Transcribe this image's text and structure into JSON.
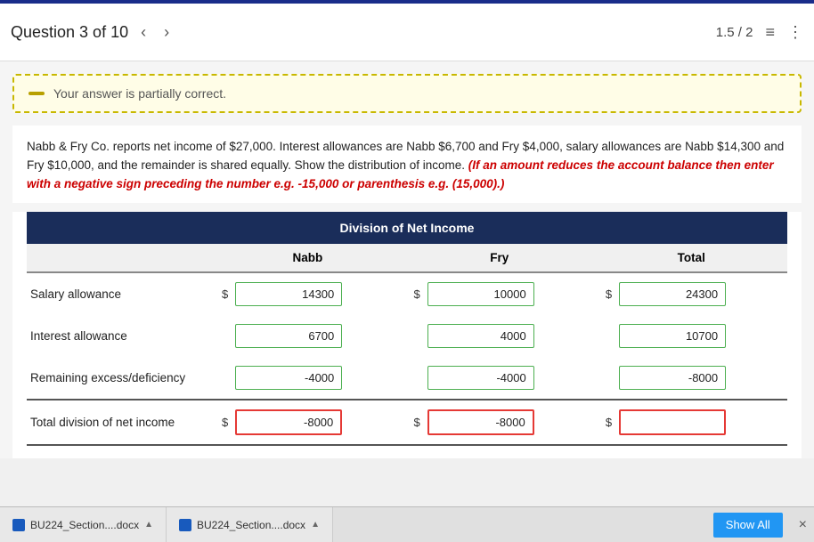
{
  "accent": "#1a2d8a",
  "header": {
    "question_label": "Question 3 of 10",
    "score": "1.5 / 2",
    "nav_prev": "‹",
    "nav_next": "›",
    "list_icon": "≡",
    "more_icon": "⋮"
  },
  "banner": {
    "text": "Your answer is partially correct."
  },
  "problem": {
    "main_text": "Nabb & Fry Co. reports net income of $27,000. Interest allowances are Nabb $6,700 and Fry $4,000, salary allowances are Nabb $14,300 and Fry $10,000, and the remainder is shared equally. Show the distribution of income.",
    "red_text": "(If an amount reduces the account balance then enter with a negative sign preceding the number e.g. -15,000 or parenthesis e.g. (15,000).)"
  },
  "table": {
    "title": "Division of Net Income",
    "columns": [
      "",
      "Nabb",
      "",
      "Fry",
      "",
      "Total"
    ],
    "col_headers": [
      "",
      "Nabb",
      "Fry",
      "Total"
    ],
    "rows": [
      {
        "label": "Salary allowance",
        "nabb_dollar": "$",
        "nabb_value": "14300",
        "fry_dollar": "$",
        "fry_value": "10000",
        "total_dollar": "$",
        "total_value": "24300",
        "nabb_red": false,
        "fry_red": false,
        "total_red": false
      },
      {
        "label": "Interest allowance",
        "nabb_dollar": "",
        "nabb_value": "6700",
        "fry_dollar": "",
        "fry_value": "4000",
        "total_dollar": "",
        "total_value": "10700",
        "nabb_red": false,
        "fry_red": false,
        "total_red": false
      },
      {
        "label": "Remaining excess/deficiency",
        "nabb_dollar": "",
        "nabb_value": "-4000",
        "fry_dollar": "",
        "fry_value": "-4000",
        "total_dollar": "",
        "total_value": "-8000",
        "nabb_red": false,
        "fry_red": false,
        "total_red": false
      },
      {
        "label": "Total division of net income",
        "nabb_dollar": "$",
        "nabb_value": "-8000",
        "fry_dollar": "$",
        "fry_value": "-8000",
        "total_dollar": "$",
        "total_value": "",
        "nabb_red": true,
        "fry_red": true,
        "total_red": true,
        "is_total": true
      }
    ]
  },
  "taskbar": {
    "item1_label": "BU224_Section....docx",
    "item2_label": "BU224_Section....docx",
    "show_all": "Show All",
    "close": "×"
  }
}
